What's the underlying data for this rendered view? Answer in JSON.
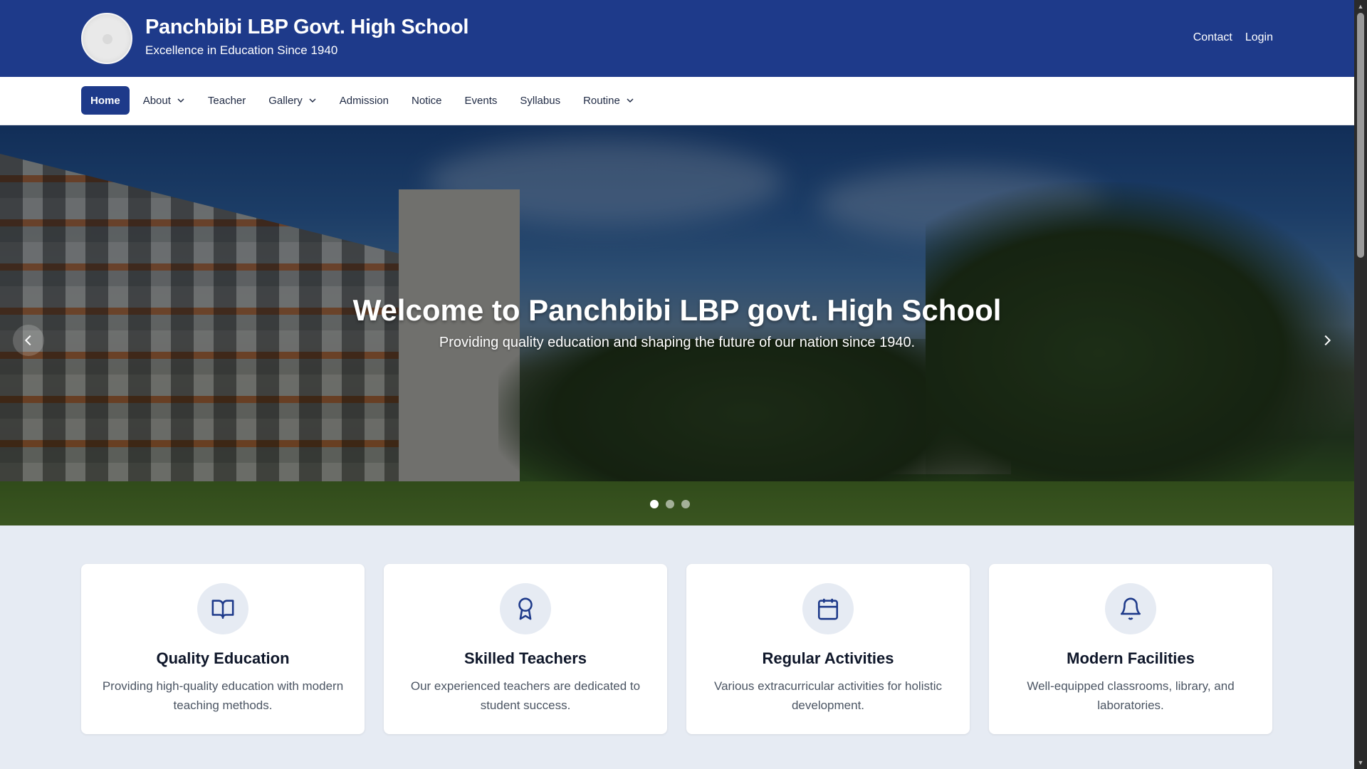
{
  "header": {
    "school_name": "Panchbibi LBP Govt. High School",
    "tagline": "Excellence in Education Since 1940",
    "links": [
      {
        "label": "Contact"
      },
      {
        "label": "Login"
      }
    ]
  },
  "nav": {
    "items": [
      {
        "label": "Home",
        "active": true,
        "dropdown": false
      },
      {
        "label": "About",
        "active": false,
        "dropdown": true
      },
      {
        "label": "Teacher",
        "active": false,
        "dropdown": false
      },
      {
        "label": "Gallery",
        "active": false,
        "dropdown": true
      },
      {
        "label": "Admission",
        "active": false,
        "dropdown": false
      },
      {
        "label": "Notice",
        "active": false,
        "dropdown": false
      },
      {
        "label": "Events",
        "active": false,
        "dropdown": false
      },
      {
        "label": "Syllabus",
        "active": false,
        "dropdown": false
      },
      {
        "label": "Routine",
        "active": false,
        "dropdown": true
      }
    ]
  },
  "hero": {
    "title": "Welcome to Panchbibi LBP govt. High School",
    "subtitle": "Providing quality education and shaping the future of our nation since 1940.",
    "slide_count": 3,
    "active_slide": 1,
    "prev_icon": "chevron-left-icon",
    "next_icon": "chevron-right-icon"
  },
  "features": [
    {
      "icon": "book-open-icon",
      "title": "Quality Education",
      "text": "Providing high-quality education with modern teaching methods."
    },
    {
      "icon": "award-icon",
      "title": "Skilled Teachers",
      "text": "Our experienced teachers are dedicated to student success."
    },
    {
      "icon": "calendar-icon",
      "title": "Regular Activities",
      "text": "Various extracurricular activities for holistic development."
    },
    {
      "icon": "bell-icon",
      "title": "Modern Facilities",
      "text": "Well-equipped classrooms, library, and laboratories."
    }
  ],
  "colors": {
    "primary": "#1e3a8a",
    "page_bg": "#e6ebf3",
    "card_bg": "#ffffff",
    "text_dark": "#0f172a",
    "text_muted": "#4b5563"
  }
}
